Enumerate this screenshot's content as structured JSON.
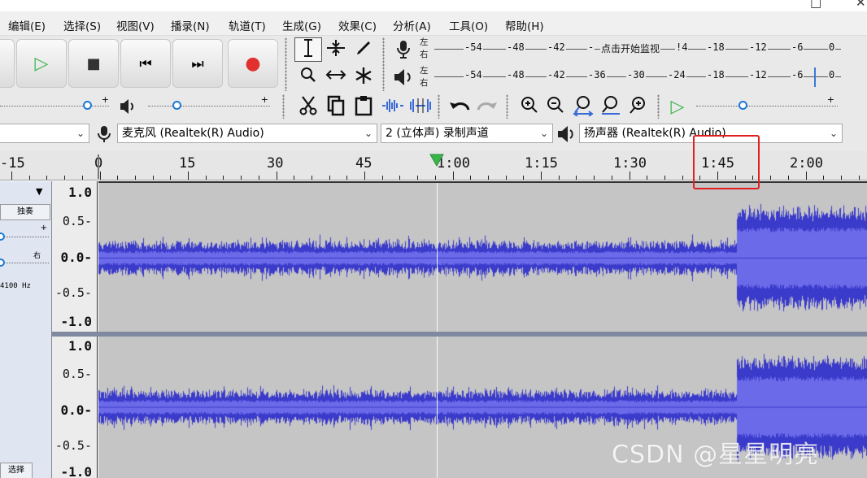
{
  "menubar": {
    "items": [
      "编辑(E)",
      "选择(S)",
      "视图(V)",
      "播录(N)",
      "轨道(T)",
      "生成(G)",
      "效果(C)",
      "分析(A)",
      "工具(O)",
      "帮助(H)"
    ]
  },
  "window_controls": {
    "minimize": "–",
    "maximize": "□",
    "close": "✕"
  },
  "meters": {
    "record": {
      "channel_left": "左",
      "channel_right": "右",
      "ticks": [
        "-54",
        "-48",
        "-42",
        "-",
        "点击开始监视",
        "-18",
        "-12",
        "-6",
        "0"
      ],
      "extra_tick": "!4"
    },
    "playback": {
      "channel_left": "左",
      "channel_right": "右",
      "ticks": [
        "-54",
        "-48",
        "-42",
        "-36",
        "-30",
        "-24",
        "-18",
        "-12",
        "-6",
        "0"
      ]
    }
  },
  "devices": {
    "host": "",
    "mic": "麦克风 (Realtek(R) Audio)",
    "channels": "2 (立体声) 录制声道",
    "speaker": "扬声器 (Realtek(R) Audio)"
  },
  "timeline": {
    "labels": [
      "-15",
      "0",
      "15",
      "30",
      "45",
      "1:00",
      "1:15",
      "1:30",
      "1:45",
      "2:00"
    ],
    "highlighted_label": "1:45"
  },
  "track_panel": {
    "solo": "独奏",
    "pan_right": "右",
    "plus": "+",
    "rate": "4100 Hz",
    "select": "选择"
  },
  "scale_top": [
    "1.0",
    "0.5-",
    "0.0-",
    "-0.5-",
    "-1.0"
  ],
  "scale_bottom": [
    "1.0",
    "0.5-",
    "0.0-",
    "-0.5-",
    "-1.0"
  ],
  "colors": {
    "waveform": "#3a3acb",
    "wave_bg": "#c5c5c5",
    "highlight": "#e02020",
    "play_green": "#39b54a",
    "record_red": "#e0312f"
  },
  "icons": {
    "play": "▷",
    "stop": "■",
    "skip_start": "⏮",
    "skip_end": "⏭",
    "record": "●"
  },
  "watermark": "CSDN @星星明亮"
}
